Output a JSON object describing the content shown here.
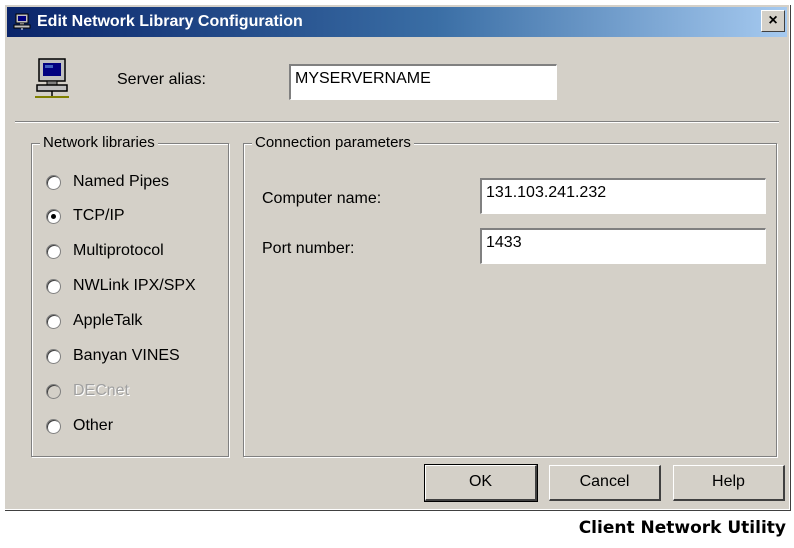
{
  "window": {
    "title": "Edit Network Library Configuration",
    "close_label": "×"
  },
  "server_alias": {
    "label": "Server alias:",
    "value": "MYSERVERNAME"
  },
  "network_libraries": {
    "title": "Network libraries",
    "options": [
      {
        "label": "Named Pipes",
        "checked": false,
        "disabled": false
      },
      {
        "label": "TCP/IP",
        "checked": true,
        "disabled": false
      },
      {
        "label": "Multiprotocol",
        "checked": false,
        "disabled": false
      },
      {
        "label": "NWLink IPX/SPX",
        "checked": false,
        "disabled": false
      },
      {
        "label": "AppleTalk",
        "checked": false,
        "disabled": false
      },
      {
        "label": "Banyan VINES",
        "checked": false,
        "disabled": false
      },
      {
        "label": "DECnet",
        "checked": false,
        "disabled": true
      },
      {
        "label": "Other",
        "checked": false,
        "disabled": false
      }
    ]
  },
  "connection_parameters": {
    "title": "Connection parameters",
    "computer_name_label": "Computer name:",
    "computer_name_value": "131.103.241.232",
    "port_label": "Port number:",
    "port_value": "1433"
  },
  "buttons": {
    "ok": "OK",
    "cancel": "Cancel",
    "help": "Help"
  },
  "caption": "Client Network Utility",
  "icons": {
    "title": "network-computer-icon",
    "alias": "computer-icon"
  }
}
